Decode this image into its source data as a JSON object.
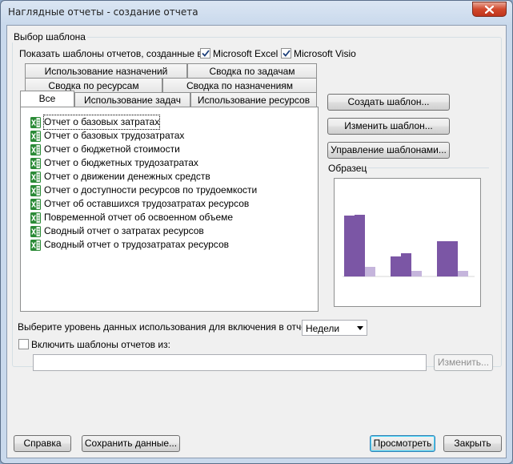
{
  "window": {
    "title": "Наглядные отчеты - создание отчета"
  },
  "template_group": {
    "label": "Выбор шаблона",
    "show_templates_label": "Показать шаблоны отчетов, созданные в:",
    "excel_label": "Microsoft Excel",
    "excel_checked": true,
    "visio_label": "Microsoft Visio",
    "visio_checked": true
  },
  "tabs": {
    "row1": [
      "Использование назначений",
      "Сводка по задачам"
    ],
    "row2": [
      "Сводка по ресурсам",
      "Сводка по назначениям"
    ],
    "row3": [
      "Все",
      "Использование задач",
      "Использование ресурсов"
    ],
    "active": "Все"
  },
  "reports": [
    "Отчет о базовых затратах",
    "Отчет о базовых трудозатратах",
    "Отчет о бюджетной стоимости",
    "Отчет о бюджетных трудозатратах",
    "Отчет о движении денежных средств",
    "Отчет о доступности ресурсов по трудоемкости",
    "Отчет об оставшихся трудозатратах ресурсов",
    "Повременной отчет об освоенном объеме",
    "Сводный отчет о затратах ресурсов",
    "Сводный отчет о трудозатратах ресурсов"
  ],
  "report_icon": "excel-icon",
  "side_buttons": {
    "create": "Создать шаблон...",
    "edit": "Изменить шаблон...",
    "manage": "Управление шаблонами..."
  },
  "sample": {
    "label": "Образец"
  },
  "usage_level": {
    "label": "Выберите уровень данных использования для включения в отчет:",
    "value": "Недели"
  },
  "include_templates": {
    "label": "Включить шаблоны отчетов из:",
    "checked": false,
    "path_value": "",
    "change_button": "Изменить..."
  },
  "footer": {
    "help": "Справка",
    "save_data": "Сохранить данные...",
    "view": "Просмотреть",
    "close": "Закрыть"
  },
  "colors": {
    "bar_dark": "#7b56a5",
    "bar_light": "#c5b5dc",
    "excel_green": "#2a8a36"
  }
}
